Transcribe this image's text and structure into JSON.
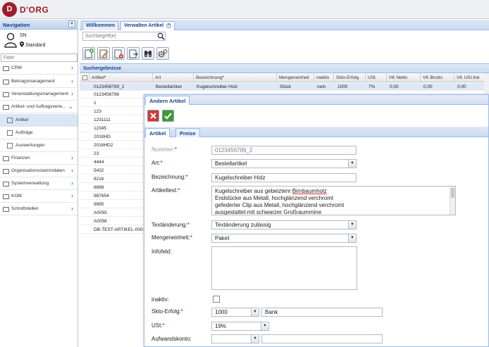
{
  "app": {
    "logo_letter": "D",
    "brand": "D'ORG"
  },
  "nav": {
    "title": "Navigation",
    "collapse_glyph": "«",
    "user": {
      "name": "SN",
      "location": "Standard"
    },
    "filter_placeholder": "Filter",
    "items": [
      {
        "label": "CRM"
      },
      {
        "label": "Beitragsmanagement"
      },
      {
        "label": "Veranstaltungsmanagement"
      },
      {
        "label": "Artikel- und Auftragsverw..."
      }
    ],
    "subitems": [
      {
        "label": "Artikel"
      },
      {
        "label": "Aufträge"
      },
      {
        "label": "Auswertungen"
      }
    ],
    "items_after": [
      {
        "label": "Finanzen"
      },
      {
        "label": "Organisationsstammdaten"
      },
      {
        "label": "Systemverwaltung"
      },
      {
        "label": "KOM"
      },
      {
        "label": "Schnittstellen"
      }
    ]
  },
  "tabs": [
    {
      "label": "Willkommen"
    },
    {
      "label": "Verwalten Artikel"
    }
  ],
  "search": {
    "placeholder": "Suchbegriff(e)"
  },
  "results": {
    "title": "Suchergebnisse",
    "columns": [
      "Artikel*",
      "Art",
      "Bezeichnung*",
      "Mengeneinheit",
      "inaktiv",
      "Skto-Erfolg",
      "USt",
      "VK Netto",
      "VK Brutto",
      "VK USt-frei"
    ],
    "first_row": [
      "0123456789_2",
      "Bestellartikel",
      "Kugelschreiber Holz",
      "Stück",
      "nein",
      "1000",
      "7%",
      "0,00",
      "0,00",
      "0,00"
    ],
    "articles": [
      "0123456798",
      "1",
      "123",
      "1231111",
      "12345",
      "2018HD",
      "2018HD2",
      "23",
      "4444",
      "5432",
      "8216",
      "8888",
      "987654",
      "9995",
      "A0055",
      "A0056",
      "DB-TEST-ARTIKEL-0001"
    ]
  },
  "dialog": {
    "title": "Ändern Artikel",
    "tabs": [
      {
        "label": "Artikel"
      },
      {
        "label": "Preise"
      }
    ],
    "fields": {
      "nummer": {
        "label": "Nummer:",
        "value": "0123456789_2"
      },
      "art": {
        "label": "Art:",
        "value": "Bestellartikel"
      },
      "bezeichnung": {
        "label": "Bezeichnung:",
        "value": "Kugelschreiber Holz"
      },
      "artikeltext": {
        "label": "Artikeltext:",
        "line1_a": "Kugelschreiber aus gebeiztem ",
        "line1_b": "Birnbaumholz",
        "line2": "Endstücke aus Metall, hochglänzend verchromt",
        "line3": "gefederter Clip aus Metall, hochglänzend verchromt",
        "line4_a": "ausgestattet mit schwarzer ",
        "line4_b": "Großraummine"
      },
      "textaenderung": {
        "label": "Textänderung:",
        "value": "Textänderung zulässig"
      },
      "mengeneinheit": {
        "label": "Mengeneinheit:",
        "value": "Paket"
      },
      "infofeld": {
        "label": "Infofeld:",
        "value": ""
      },
      "inaktiv": {
        "label": "inaktiv:"
      },
      "skto": {
        "label": "Skto-Erfolg:",
        "value": "1000",
        "text": "Bank"
      },
      "ust": {
        "label": "USt:",
        "value": "19%"
      },
      "aufwandskonto": {
        "label": "Aufwandskonto:",
        "value": "",
        "text": ""
      }
    }
  },
  "colors": {
    "accent": "#a01c2c",
    "header_blue": "#15428b",
    "required": "#dd0000"
  }
}
